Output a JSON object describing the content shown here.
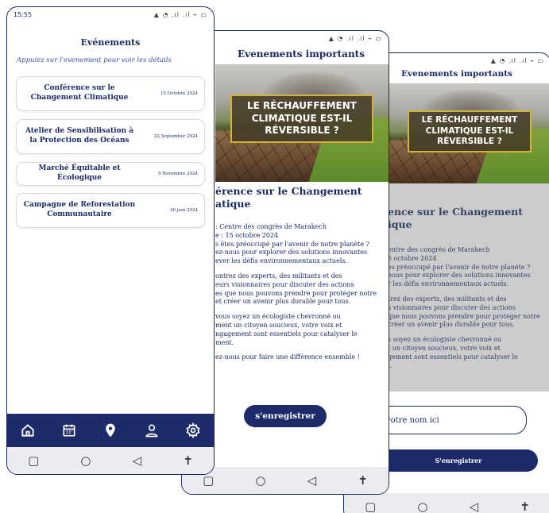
{
  "status": {
    "time": "15:55",
    "icons": "▲ ◔ .ıl .ıl ⌁ ▭"
  },
  "phone1": {
    "title": "Evénements",
    "subtitle": "Appuiez sur l'evenement pour voir les détails",
    "events": [
      {
        "name": "Conférence sur le Changement Climatique",
        "date": "15 Octobre 2024"
      },
      {
        "name": "Atelier de Sensibilisation à la Protection des Océans",
        "date": "22 September 2024"
      },
      {
        "name": "Marché Équitable et Écologique",
        "date": "5 Novembre 2024"
      },
      {
        "name": "Campagne de Reforestation Communautaire",
        "date": "30 juin 2024"
      }
    ],
    "tabs": [
      "home-icon",
      "calendar-icon",
      "location-pin-icon",
      "user-icon",
      "settings-gear-icon"
    ]
  },
  "phone2": {
    "title": "Evenements importants",
    "banner_text": "LE RÉCHAUFFEMENT CLIMATIQUE EST-IL RÉVERSIBLE ?",
    "detail_title": "érence sur le Changement atique",
    "body": [
      ": Centre des congrès de Marakech",
      "e : 15 octobre 2024",
      "s êtes préoccupé par l'avenir de notre planète ?",
      "ez-nous pour explorer des solutions innovantes",
      "ever les défis environnementaux actuels.",
      "ontrez des experts, des militants et des",
      "eurs visionnaires pour discuter des actions",
      "es que nous pouvons prendre pour protéger notre",
      "et créer un avenir plus durable pour tous.",
      "vous soyez un écologiste chevronné ou",
      "ment un citoyen soucieux, votre voix et",
      "ngagement sont essentiels pour catalyser le",
      "ment.",
      "ez-nous pour faire une différence ensemble !"
    ],
    "button": "s'enregistrer"
  },
  "phone3": {
    "title": "Evenements importants",
    "banner_text": "LE RÉCHAUFFEMENT CLIMATIQUE EST-IL RÉVERSIBLE ?",
    "detail_title": "ence sur le Changement ique",
    "body": [
      "entre des congrès de Marakech",
      "5 octobre 2024",
      "es préoccupé par l'avenir de notre planète ?",
      "nous pour explorer des solutions innovantes",
      "r les défis environnementaux actuels.",
      "trez des experts, des militants et des",
      "s visionnaires pour discuter des actions",
      "que nous pouvons prendre pour protéger notre",
      "créer un avenir plus durable pour tous.",
      "s soyez un écologiste chevronné ou",
      "t un citoyen soucieux, votre voix et",
      "gement sont essentiels pour catalyser le",
      "t."
    ],
    "input_value": "votre nom ici",
    "button": "S'enregistrer"
  },
  "sysnav": {
    "square": "▢",
    "circle": "○",
    "back": "◁",
    "accessibility": "✝"
  }
}
